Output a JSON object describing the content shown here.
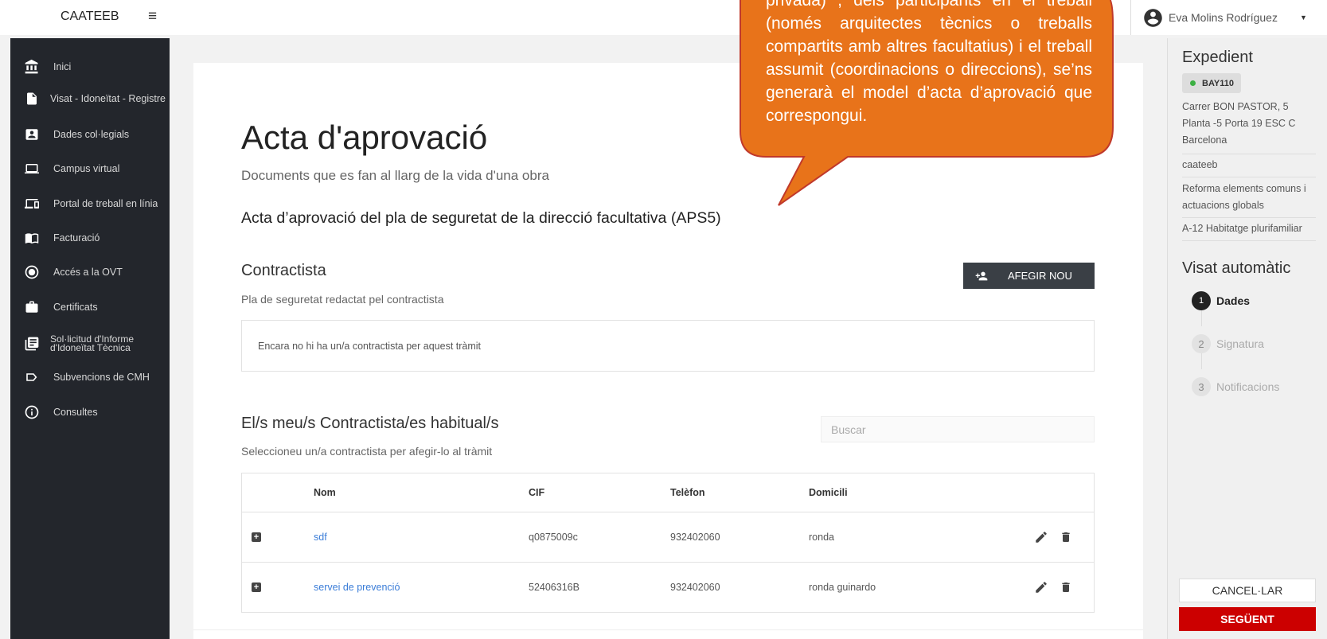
{
  "topbar": {
    "brand": "CAATEEB",
    "user_name": "Eva Molins Rodríguez"
  },
  "sidebar": {
    "items": [
      {
        "label": "Inici",
        "icon": "bank-icon"
      },
      {
        "label": "Visat - Idoneïtat - Registre",
        "icon": "file-icon"
      },
      {
        "label": "Dades col·legials",
        "icon": "badge-icon"
      },
      {
        "label": "Campus virtual",
        "icon": "laptop-icon"
      },
      {
        "label": "Portal de treball en línia",
        "icon": "devices-icon"
      },
      {
        "label": "Facturació",
        "icon": "book-icon"
      },
      {
        "label": "Accés a la OVT",
        "icon": "target-icon"
      },
      {
        "label": "Certificats",
        "icon": "briefcase-icon"
      },
      {
        "label": "Sol·licitud d'Informe d'Idoneïtat Tècnica",
        "icon": "library-icon"
      },
      {
        "label": "Subvencions de CMH",
        "icon": "label-icon"
      },
      {
        "label": "Consultes",
        "icon": "info-icon"
      }
    ]
  },
  "main": {
    "title": "Acta d'aprovació",
    "subtitle": "Documents que es fan al llarg de la vida d'una obra",
    "doc_title": "Acta d’aprovació del pla de seguretat de la direcció facultativa (APS5)",
    "contractista": {
      "title": "Contractista",
      "subtitle": "Pla de seguretat redactat pel contractista",
      "add_button": "AFEGIR NOU",
      "empty_text": "Encara no hi ha un/a contractista per aquest tràmit"
    },
    "habitual": {
      "title": "El/s meu/s Contractista/es habitual/s",
      "subtitle": "Seleccioneu un/a contractista per afegir-lo al tràmit",
      "search_placeholder": "Buscar",
      "columns": [
        "Nom",
        "CIF",
        "Telèfon",
        "Domicili"
      ],
      "rows": [
        {
          "nom": "sdf",
          "cif": "q0875009c",
          "telefon": "932402060",
          "domicili": "ronda"
        },
        {
          "nom": "servei de prevenció",
          "cif": "52406316B",
          "telefon": "932402060",
          "domicili": "ronda guinardo"
        }
      ]
    }
  },
  "right_panel": {
    "expedient_title": "Expedient",
    "badge": "BAY110",
    "badge_color": "#3cb043",
    "address": "Carrer BON PASTOR, 5 Planta -5 Porta 19 ESC C Barcelona",
    "client": "caateeb",
    "description": "Reforma elements comuns i actuacions globals",
    "typology": "A-12 Habitatge plurifamiliar",
    "visat_title": "Visat automàtic",
    "steps": [
      {
        "num": "1",
        "label": "Dades"
      },
      {
        "num": "2",
        "label": "Signatura"
      },
      {
        "num": "3",
        "label": "Notificacions"
      }
    ],
    "cancel_label": "CANCEL·LAR",
    "next_label": "SEGÜENT",
    "next_color": "#cc0000"
  },
  "callout": {
    "text": "privada) , dels participants en el treball (només arquitectes tècnics o treballs compartits amb altres facultatius) i el treball assumit (coordinacions o direccions), se’ns generarà el model d’acta d’aprovació que correspongui.",
    "color": "#e8731a"
  }
}
